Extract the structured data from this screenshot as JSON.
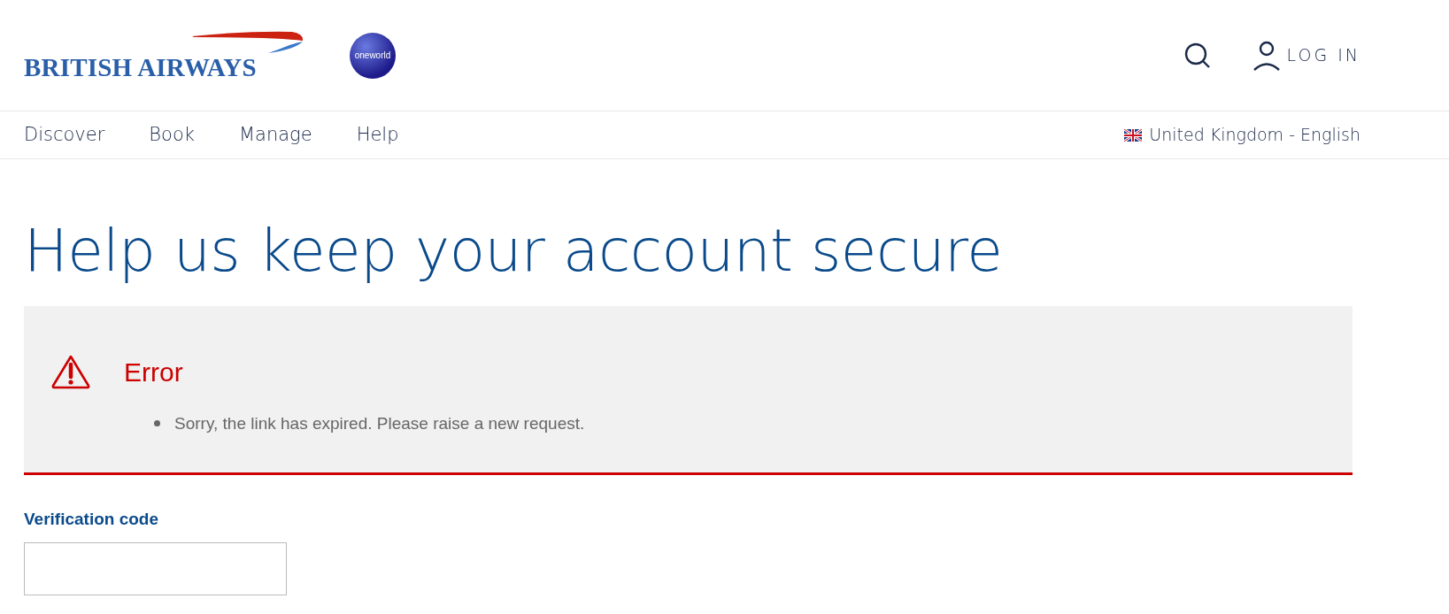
{
  "header": {
    "logo_text": "BRITISH AIRWAYS",
    "partner_badge": "oneworld",
    "login": "LOG IN"
  },
  "nav": {
    "items": [
      {
        "label": "Discover"
      },
      {
        "label": "Book"
      },
      {
        "label": "Manage"
      },
      {
        "label": "Help"
      }
    ],
    "locale": "United Kingdom - English"
  },
  "page": {
    "title": "Help us keep your account secure"
  },
  "alert": {
    "title": "Error",
    "messages": [
      "Sorry, the link has expired. Please raise a new request."
    ]
  },
  "form": {
    "fields": [
      {
        "label": "Verification code"
      }
    ]
  }
}
